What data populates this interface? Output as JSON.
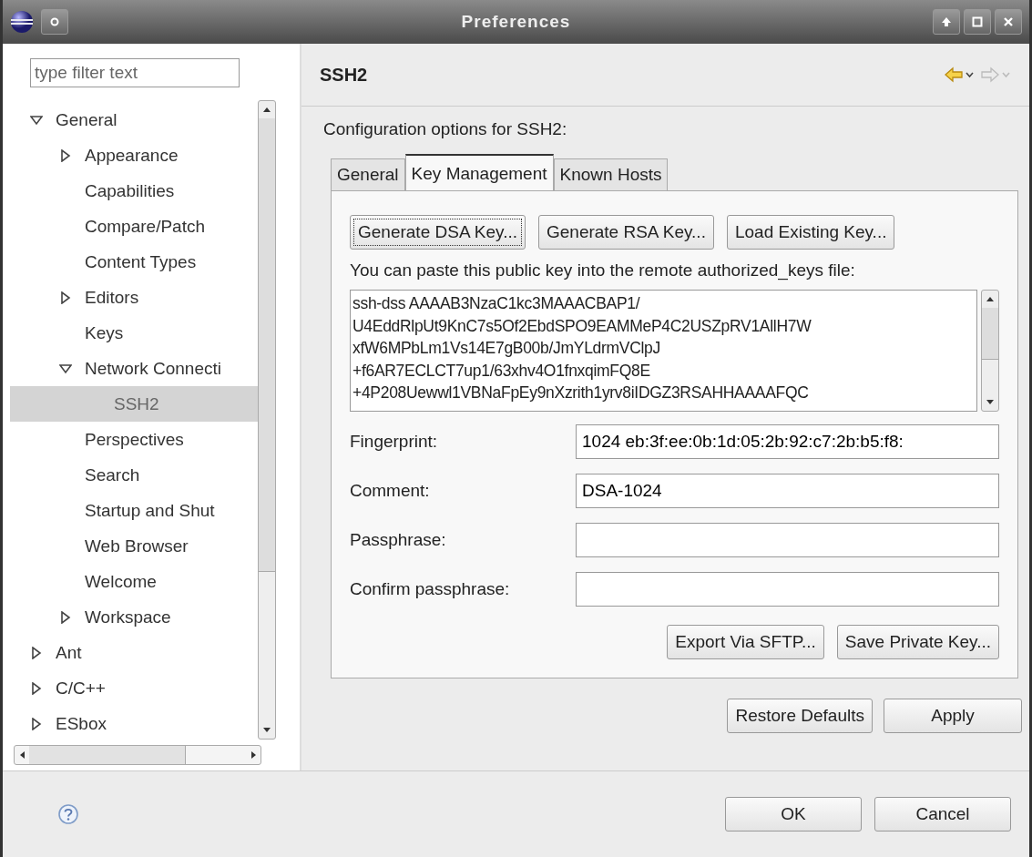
{
  "window": {
    "title": "Preferences"
  },
  "filter": {
    "placeholder": "type filter text"
  },
  "tree": [
    {
      "label": "General",
      "expanded": true,
      "selected": false,
      "children": [
        {
          "label": "Appearance",
          "expanded": false,
          "selected": false
        },
        {
          "label": "Capabilities",
          "selected": false
        },
        {
          "label": "Compare/Patch",
          "selected": false
        },
        {
          "label": "Content Types",
          "selected": false
        },
        {
          "label": "Editors",
          "expanded": false,
          "selected": false
        },
        {
          "label": "Keys",
          "selected": false
        },
        {
          "label": "Network Connecti",
          "expanded": true,
          "selected": false,
          "children": [
            {
              "label": "SSH2",
              "selected": true
            }
          ]
        },
        {
          "label": "Perspectives",
          "selected": false
        },
        {
          "label": "Search",
          "selected": false
        },
        {
          "label": "Startup and Shut",
          "selected": false
        },
        {
          "label": "Web Browser",
          "selected": false
        },
        {
          "label": "Welcome",
          "selected": false
        },
        {
          "label": "Workspace",
          "expanded": false,
          "selected": false
        }
      ]
    },
    {
      "label": "Ant",
      "expanded": false,
      "selected": false
    },
    {
      "label": "C/C++",
      "expanded": false,
      "selected": false
    },
    {
      "label": "ESbox",
      "expanded": false,
      "selected": false
    }
  ],
  "page": {
    "title": "SSH2",
    "description": "Configuration options for SSH2:",
    "tabs": [
      {
        "label": "General",
        "selected": false
      },
      {
        "label": "Key Management",
        "selected": true
      },
      {
        "label": "Known Hosts",
        "selected": false
      }
    ],
    "key_buttons": [
      "Generate DSA Key...",
      "Generate RSA Key...",
      "Load Existing Key..."
    ],
    "key_hint": "You can paste this public key into the remote authorized_keys file:",
    "public_key_lines": [
      "ssh-dss AAAAB3NzaC1kc3MAAACBAP1/",
      "U4EddRlpUt9KnC7s5Of2EbdSPO9EAMMeP4C2USZpRV1AllH7W",
      "xfW6MPbLm1Vs14E7gB00b/JmYLdrmVClpJ",
      "+f6AR7ECLCT7up1/63xhv4O1fnxqimFQ8E",
      "+4P208Uewwl1VBNaFpEy9nXzrith1yrv8iIDGZ3RSAHHAAAAFQC"
    ],
    "fields": [
      {
        "label": "Fingerprint:",
        "value": "1024 eb:3f:ee:0b:1d:05:2b:92:c7:2b:b5:f8:"
      },
      {
        "label": "Comment:",
        "value": "DSA-1024"
      },
      {
        "label": "Passphrase:"
      },
      {
        "label": "Confirm passphrase:"
      }
    ],
    "action_buttons": [
      "Export Via SFTP...",
      "Save Private Key..."
    ],
    "page_buttons": [
      "Restore Defaults",
      "Apply"
    ]
  },
  "dialog_buttons": [
    "OK",
    "Cancel"
  ]
}
